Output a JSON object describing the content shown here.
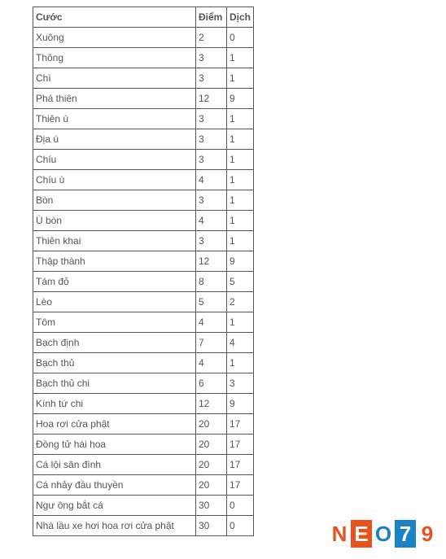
{
  "headers": {
    "cuoc": "Cước",
    "diem": "Điểm",
    "dich": "Dịch"
  },
  "rows": [
    {
      "cuoc": "Xuông",
      "diem": "2",
      "dich": "0"
    },
    {
      "cuoc": "Thông",
      "diem": "3",
      "dich": "1"
    },
    {
      "cuoc": "Chì",
      "diem": "3",
      "dich": "1"
    },
    {
      "cuoc": "Phá thiên",
      "diem": "12",
      "dich": "9"
    },
    {
      "cuoc": "Thiên ù",
      "diem": "3",
      "dich": "1"
    },
    {
      "cuoc": "Địa ù",
      "diem": "3",
      "dich": "1"
    },
    {
      "cuoc": "Chíu",
      "diem": "3",
      "dich": "1"
    },
    {
      "cuoc": "Chíu ù",
      "diem": "4",
      "dich": "1"
    },
    {
      "cuoc": "Bòn",
      "diem": "3",
      "dich": "1"
    },
    {
      "cuoc": "Ù bòn",
      "diem": "4",
      "dich": "1"
    },
    {
      "cuoc": "Thiên khai",
      "diem": "3",
      "dich": "1"
    },
    {
      "cuoc": "Thập thành",
      "diem": "12",
      "dich": "9"
    },
    {
      "cuoc": "Tám đỏ",
      "diem": "8",
      "dich": "5"
    },
    {
      "cuoc": "Lèo",
      "diem": "5",
      "dich": "2"
    },
    {
      "cuoc": "Tôm",
      "diem": "4",
      "dich": "1"
    },
    {
      "cuoc": "Bạch định",
      "diem": "7",
      "dich": "4"
    },
    {
      "cuoc": "Bạch thủ",
      "diem": "4",
      "dich": "1"
    },
    {
      "cuoc": "Bạch thủ chi",
      "diem": "6",
      "dich": "3"
    },
    {
      "cuoc": "Kính tứ chi",
      "diem": "12",
      "dich": "9"
    },
    {
      "cuoc": "Hoa rơi cửa phật",
      "diem": "20",
      "dich": "17"
    },
    {
      "cuoc": "Đồng tử hái hoa",
      "diem": "20",
      "dich": "17"
    },
    {
      "cuoc": "Cá lội sân đình",
      "diem": "20",
      "dich": "17"
    },
    {
      "cuoc": "Cá nhảy đầu thuyền",
      "diem": "20",
      "dich": "17"
    },
    {
      "cuoc": "Ngư ông bắt cá",
      "diem": "30",
      "dich": "0"
    },
    {
      "cuoc": "Nhà lầu xe hơi hoa rơi cửa phật",
      "diem": "30",
      "dich": "0"
    }
  ],
  "logo": {
    "n": "N",
    "e": "E",
    "o": "O",
    "seven": "7",
    "nine": "9"
  }
}
